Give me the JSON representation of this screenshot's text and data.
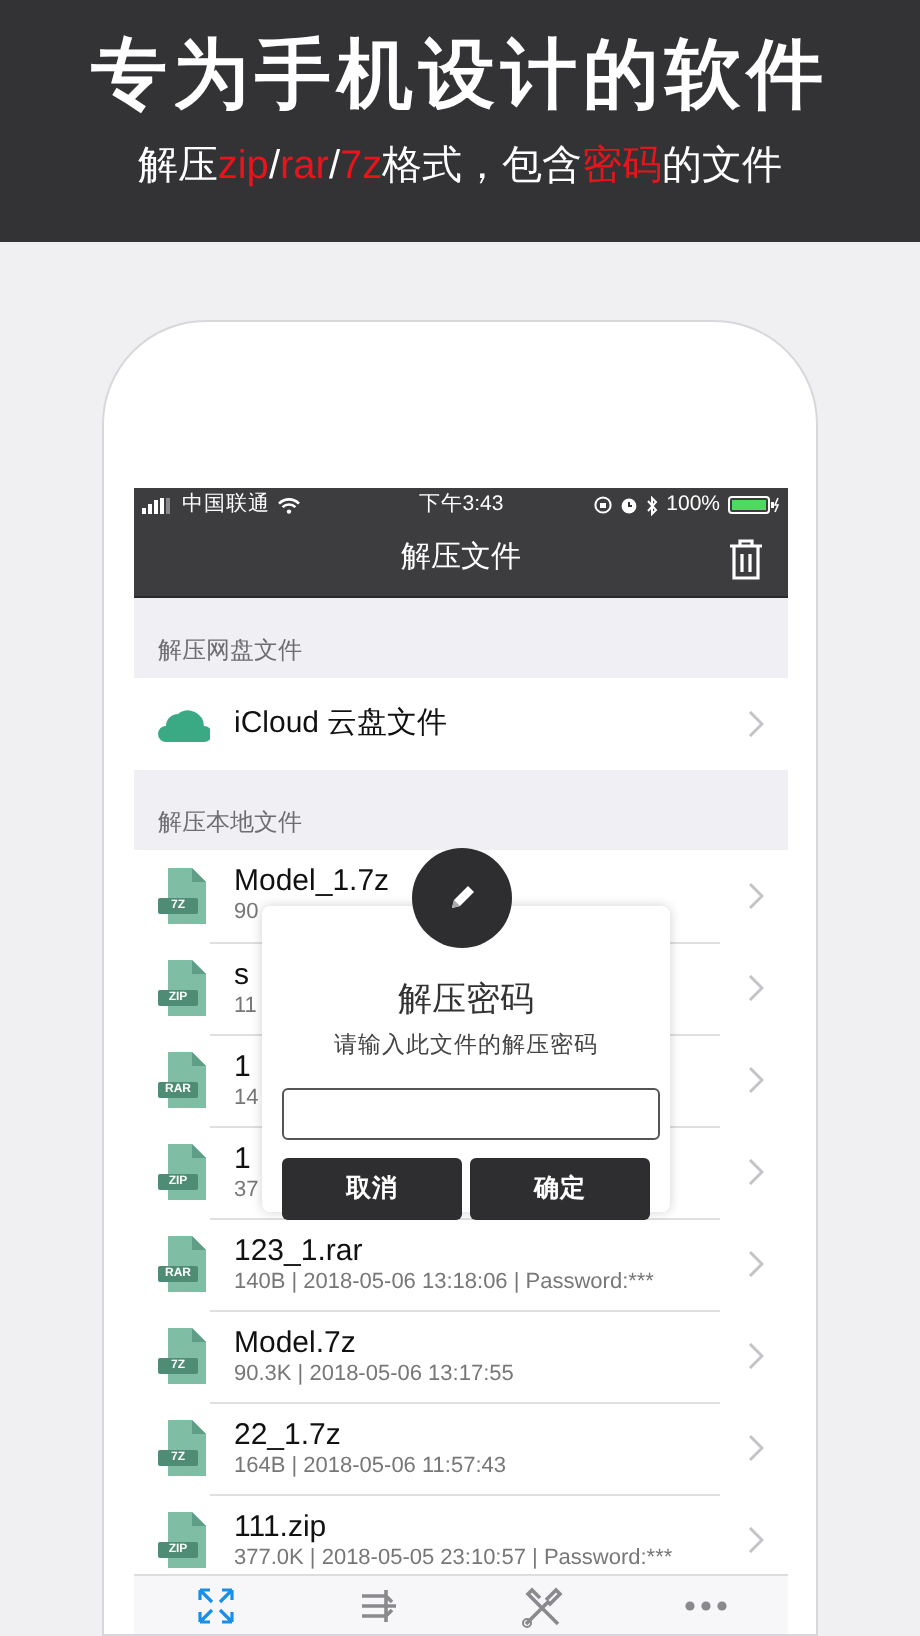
{
  "banner": {
    "headline": "专为手机设计的软件",
    "tagline": [
      {
        "text": "解压",
        "highlight": false
      },
      {
        "text": "zip",
        "highlight": true
      },
      {
        "text": "/",
        "highlight": false
      },
      {
        "text": "rar",
        "highlight": true
      },
      {
        "text": "/",
        "highlight": false
      },
      {
        "text": "7z",
        "highlight": true
      },
      {
        "text": "格式，包含",
        "highlight": false
      },
      {
        "text": "密码",
        "highlight": true
      },
      {
        "text": "的文件",
        "highlight": false
      }
    ]
  },
  "status_bar": {
    "carrier": "中国联通",
    "time": "下午3:43",
    "battery": "100%"
  },
  "nav": {
    "title": "解压文件"
  },
  "sections": [
    {
      "header": "解压网盘文件",
      "items": [
        {
          "kind": "cloud",
          "name": "iCloud 云盘文件"
        }
      ]
    },
    {
      "header": "解压本地文件",
      "items": [
        {
          "kind": "file",
          "type_label": "7Z",
          "name": "Model_1.7z",
          "detail": "90"
        },
        {
          "kind": "file",
          "type_label": "ZIP",
          "name": "s",
          "detail": "11"
        },
        {
          "kind": "file",
          "type_label": "RAR",
          "name": "1",
          "detail": "14"
        },
        {
          "kind": "file",
          "type_label": "ZIP",
          "name": "1",
          "detail": "37"
        },
        {
          "kind": "file",
          "type_label": "RAR",
          "name": "123_1.rar",
          "detail": "140B | 2018-05-06 13:18:06 | Password:***"
        },
        {
          "kind": "file",
          "type_label": "7Z",
          "name": "Model.7z",
          "detail": "90.3K | 2018-05-06 13:17:55"
        },
        {
          "kind": "file",
          "type_label": "7Z",
          "name": "22_1.7z",
          "detail": "164B | 2018-05-06 11:57:43"
        },
        {
          "kind": "file",
          "type_label": "ZIP",
          "name": "111.zip",
          "detail": "377.0K | 2018-05-05 23:10:57 | Password:***"
        }
      ]
    }
  ],
  "dialog": {
    "title": "解压密码",
    "message": "请输入此文件的解压密码",
    "buttons": [
      "取消",
      "确定"
    ]
  },
  "tab_bar": [
    {
      "kind": "expand",
      "selected": true
    },
    {
      "kind": "switch",
      "selected": false
    },
    {
      "kind": "tools",
      "selected": false
    },
    {
      "kind": "more",
      "selected": false
    }
  ]
}
